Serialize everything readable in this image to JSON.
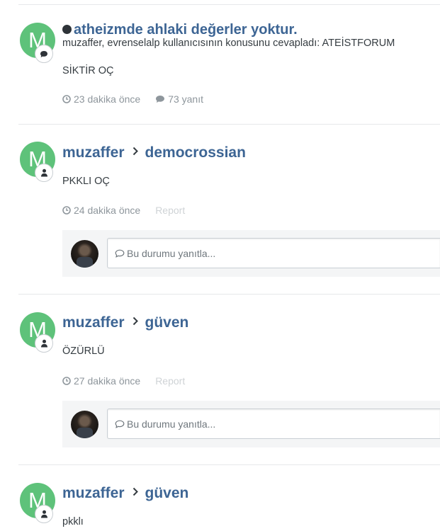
{
  "feed": {
    "entries": [
      {
        "avatar_letter": "M",
        "badge_icon": "comment-icon",
        "title": "atheizmde ahlaki değerler yoktur.",
        "subtitle": "muzaffer, evrenselalp kullanıcısının konusunu cevapladı: ATEİSTFORUM",
        "body": "SİKTİR OÇ",
        "time": "23 dakika önce",
        "replies": "73 yanıt"
      },
      {
        "avatar_letter": "M",
        "badge_icon": "user-icon",
        "author": "muzaffer",
        "target": "democrossian",
        "body": "PKKLI OÇ",
        "time": "24 dakika önce",
        "report": "Report",
        "reply_placeholder": "Bu durumu yanıtla..."
      },
      {
        "avatar_letter": "M",
        "badge_icon": "user-icon",
        "author": "muzaffer",
        "target": "güven",
        "body": "ÖZÜRLÜ",
        "time": "27 dakika önce",
        "report": "Report",
        "reply_placeholder": "Bu durumu yanıtla..."
      },
      {
        "avatar_letter": "M",
        "badge_icon": "user-icon",
        "author": "muzaffer",
        "target": "güven",
        "body": "pkklı"
      }
    ]
  },
  "colors": {
    "link": "#3d6594",
    "avatar_bg": "#5ec27a",
    "meta": "#8e969c",
    "divider": "#e6e8ea"
  }
}
